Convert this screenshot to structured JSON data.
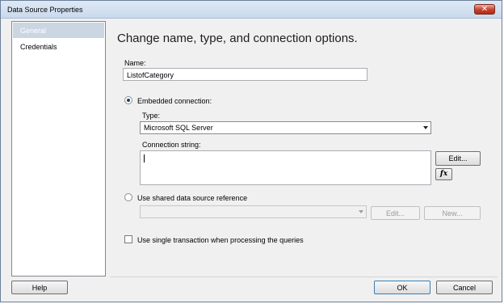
{
  "window": {
    "title": "Data Source Properties",
    "close_glyph": "✕"
  },
  "sidebar": {
    "items": [
      {
        "label": "General",
        "selected": true
      },
      {
        "label": "Credentials",
        "selected": false
      }
    ]
  },
  "main": {
    "heading": "Change name, type, and connection options.",
    "name_label": "Name:",
    "name_value": "ListofCategory",
    "embedded_label": "Embedded connection:",
    "embedded_selected": true,
    "type_label": "Type:",
    "type_value": "Microsoft SQL Server",
    "conn_label": "Connection string:",
    "conn_value": "",
    "edit_label": "Edit...",
    "fx_label": "fx",
    "shared_label": "Use shared data source reference",
    "shared_selected": false,
    "shared_value": "",
    "shared_edit_label": "Edit...",
    "shared_new_label": "New...",
    "single_tx_label": "Use single transaction when processing the queries",
    "single_tx_checked": false
  },
  "footer": {
    "help_label": "Help",
    "ok_label": "OK",
    "cancel_label": "Cancel"
  },
  "colors": {
    "selected_item_bg": "#cbd6e3",
    "close_button": "#c7402c"
  }
}
